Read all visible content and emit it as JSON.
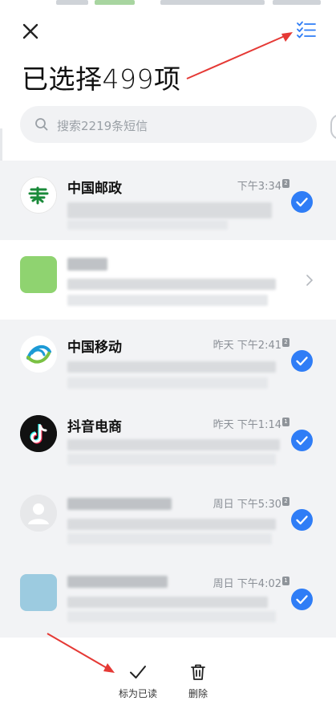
{
  "header": {
    "title": "已选择499项"
  },
  "search": {
    "placeholder": "搜索2219条短信"
  },
  "messages": [
    {
      "sender": "中国邮政",
      "time": "下午3:34",
      "sim": "2",
      "selected": true
    },
    {
      "sender": "",
      "time": "",
      "sim": "",
      "selected": false
    },
    {
      "sender": "中国移动",
      "time": "昨天 下午2:41",
      "sim": "2",
      "selected": true
    },
    {
      "sender": "抖音电商",
      "time": "昨天 下午1:14",
      "sim": "1",
      "selected": true
    },
    {
      "sender": "",
      "time": "周日 下午5:30",
      "sim": "2",
      "selected": true
    },
    {
      "sender": "",
      "time": "周日 下午4:02",
      "sim": "1",
      "selected": true
    }
  ],
  "actions": {
    "mark_read": "标为已读",
    "delete": "删除"
  },
  "colors": {
    "accent": "#2f7df6",
    "annotation_arrow": "#e53935",
    "selected_row_bg": "#f2f3f5"
  },
  "icons": [
    "close-icon",
    "select-all-icon",
    "search-icon",
    "check-icon",
    "chevron-right-icon",
    "trash-icon"
  ]
}
